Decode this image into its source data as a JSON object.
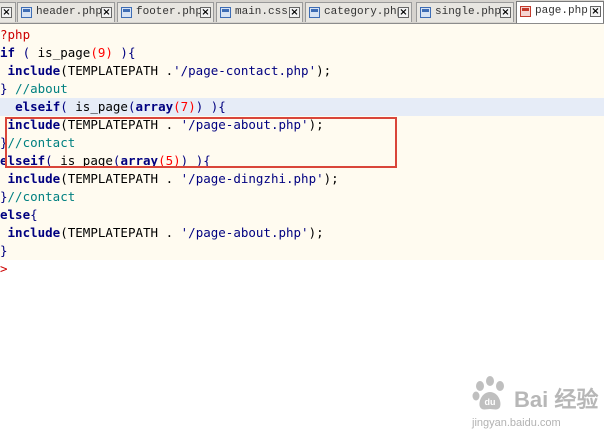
{
  "tabs": [
    {
      "label": "header.php",
      "active": false
    },
    {
      "label": "footer.php",
      "active": false
    },
    {
      "label": "main.css",
      "active": false
    },
    {
      "label": "category.php",
      "active": false
    },
    {
      "label": "single.php",
      "active": false
    },
    {
      "label": "page.php",
      "active": true
    }
  ],
  "code": {
    "l1_open": "?php",
    "l2_if": "if",
    "l2_paren1": " ( ",
    "l2_fn": "is_page",
    "l2_arg": "(9)",
    "l2_end": " ){",
    "l3_indent": " ",
    "l3_kw": "include",
    "l3_rest": "(TEMPLATEPATH .",
    "l3_str": "'/page-contact.php'",
    "l3_end": ");",
    "l4_brace": "} ",
    "l4_cmt": "//about",
    "l5_kw": "elseif",
    "l5_p": "( ",
    "l5_fn": "is_page",
    "l5_paren": "(",
    "l5_arr": "array",
    "l5_num": "(7)",
    "l5_end": ") ){",
    "l6_kw": "include",
    "l6_rest": "(TEMPLATEPATH . ",
    "l6_str": "'/page-about.php'",
    "l6_end": ");",
    "l7_brace": "}",
    "l7_cmt": "//contact",
    "l8_kw": "elseif",
    "l8_p": "( ",
    "l8_fn": "is_page",
    "l8_paren": "(",
    "l8_arr": "array",
    "l8_num": "(5)",
    "l8_end": ") ){",
    "l9_kw": "include",
    "l9_rest": "(TEMPLATEPATH . ",
    "l9_str": "'/page-dingzhi.php'",
    "l9_end": ");",
    "l10_brace": "}",
    "l10_cmt": "//contact",
    "l11_kw": "else",
    "l11_end": "{",
    "l12_kw": "include",
    "l12_rest": "(TEMPLATEPATH . ",
    "l12_str": "'/page-about.php'",
    "l12_end": ");",
    "l13_brace": "}",
    "l14_close": ">"
  },
  "watermark": {
    "brand": "Bai 经验",
    "url": "jingyan.baidu.com"
  },
  "colors": {
    "highlight_box": "#d9453a",
    "editor_bg": "#fffbf0",
    "current_line": "#e6ecf7"
  }
}
